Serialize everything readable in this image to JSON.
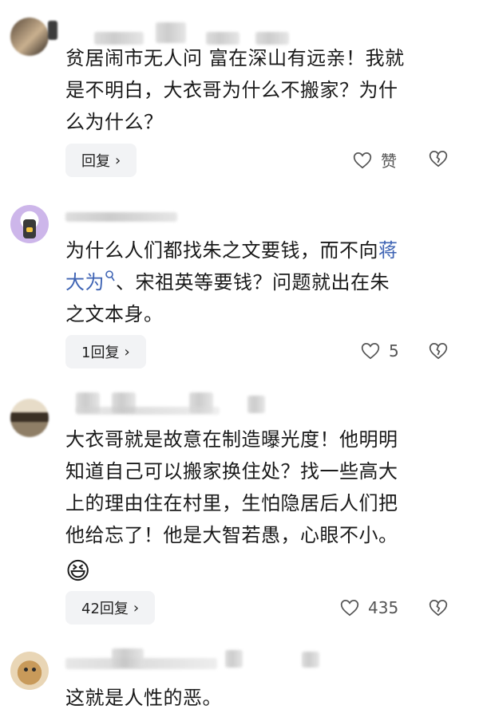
{
  "comments": [
    {
      "text_lines": [
        "贫居闹市无人问 富在深山有远亲！我就",
        "是不明白，大衣哥为什么不搬家？为什",
        "么为什么？"
      ],
      "reply_label": "回复",
      "like_label": "赞"
    },
    {
      "text_pre": "为什么人们都找朱之文要钱，而不向",
      "link_a": "蒋",
      "link_b": "大为",
      "text_after_link": "、宋祖英等要钱？问题就出在朱",
      "text_line3": "之文本身。",
      "reply_label": "1回复",
      "like_count": "5"
    },
    {
      "text_lines": [
        "大衣哥就是故意在制造曝光度！他明明",
        "知道自己可以搬家换住处？找一些高大",
        "上的理由住在村里，生怕隐居后人们把",
        "他给忘了！他是大智若愚，心眼不小。"
      ],
      "emoji": "😆",
      "reply_label": "42回复",
      "like_count": "435"
    },
    {
      "text_lines": [
        "这就是人性的恶。"
      ]
    }
  ],
  "icons": {
    "reply_chevron": "chevron-right-icon",
    "like": "heart-icon",
    "dislike": "broken-heart-icon",
    "search": "search-icon"
  },
  "colors": {
    "link": "#3f64b4",
    "reply_bg": "#f2f3f5"
  }
}
